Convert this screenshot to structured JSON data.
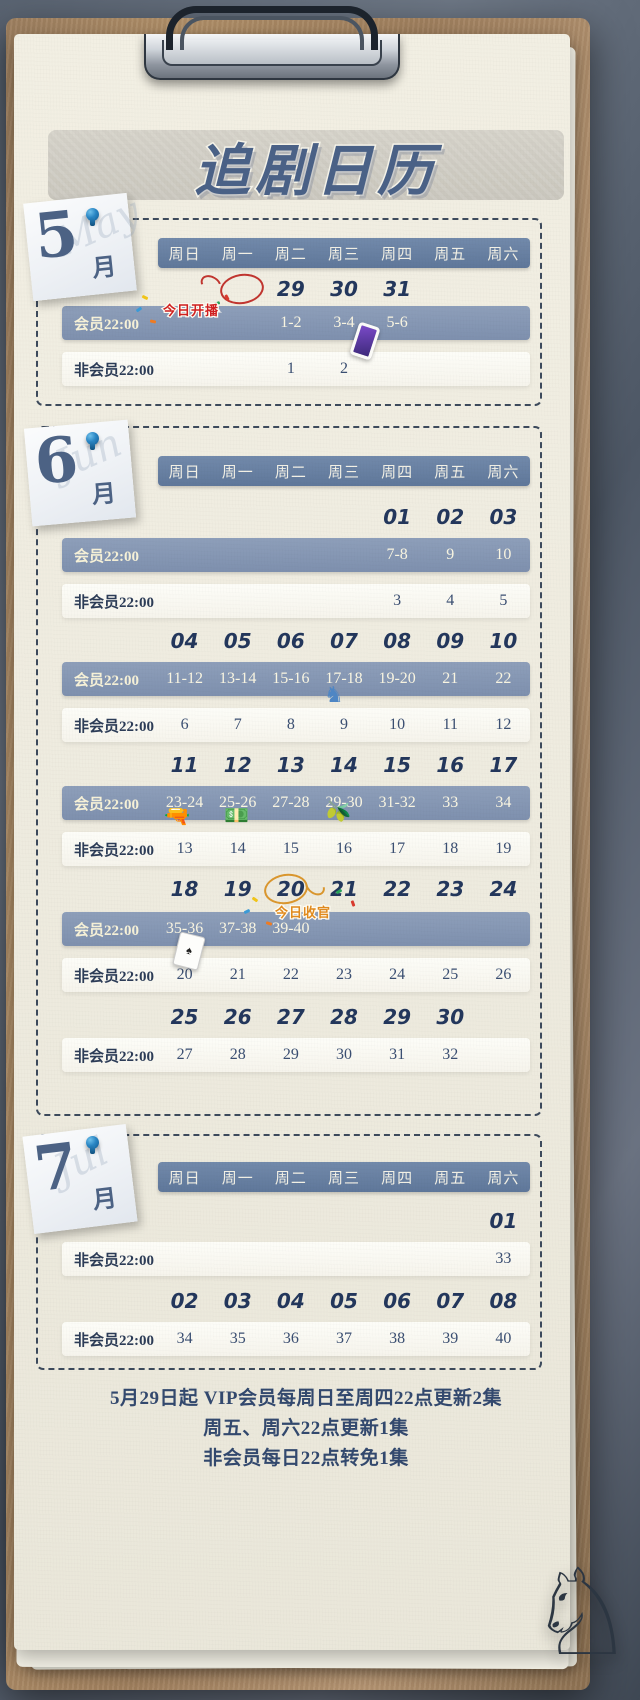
{
  "page": {
    "title": "追剧日历",
    "weekday_headers": [
      "周日",
      "周一",
      "周二",
      "周三",
      "周四",
      "周五",
      "周六"
    ],
    "vip_label": "会员22:00",
    "free_label": "非会员22:00"
  },
  "badges": {
    "premiere": "今日开播",
    "finale": "今日收官"
  },
  "months": [
    {
      "number": "5",
      "unit": "月",
      "script": "May",
      "weeks": [
        {
          "dates": [
            "",
            "",
            "29",
            "30",
            "31",
            "",
            ""
          ],
          "vip": [
            "",
            "",
            "1-2",
            "3-4",
            "5-6",
            "",
            ""
          ],
          "free": [
            "",
            "",
            "1",
            "2",
            "",
            "",
            ""
          ]
        }
      ]
    },
    {
      "number": "6",
      "unit": "月",
      "script": "Jun",
      "weeks": [
        {
          "dates": [
            "",
            "",
            "",
            "",
            "01",
            "02",
            "03"
          ],
          "vip": [
            "",
            "",
            "",
            "",
            "7-8",
            "9",
            "10"
          ],
          "free": [
            "",
            "",
            "",
            "",
            "3",
            "4",
            "5"
          ]
        },
        {
          "dates": [
            "04",
            "05",
            "06",
            "07",
            "08",
            "09",
            "10"
          ],
          "vip": [
            "11-12",
            "13-14",
            "15-16",
            "17-18",
            "19-20",
            "21",
            "22"
          ],
          "free": [
            "6",
            "7",
            "8",
            "9",
            "10",
            "11",
            "12"
          ]
        },
        {
          "dates": [
            "11",
            "12",
            "13",
            "14",
            "15",
            "16",
            "17"
          ],
          "vip": [
            "23-24",
            "25-26",
            "27-28",
            "29-30",
            "31-32",
            "33",
            "34"
          ],
          "free": [
            "13",
            "14",
            "15",
            "16",
            "17",
            "18",
            "19"
          ]
        },
        {
          "dates": [
            "18",
            "19",
            "20",
            "21",
            "22",
            "23",
            "24"
          ],
          "vip": [
            "35-36",
            "37-38",
            "39-40",
            "",
            "",
            "",
            ""
          ],
          "free": [
            "20",
            "21",
            "22",
            "23",
            "24",
            "25",
            "26"
          ]
        },
        {
          "dates": [
            "25",
            "26",
            "27",
            "28",
            "29",
            "30",
            ""
          ],
          "vip": null,
          "free": [
            "27",
            "28",
            "29",
            "30",
            "31",
            "32",
            ""
          ]
        }
      ]
    },
    {
      "number": "7",
      "unit": "月",
      "script": "Jul",
      "weeks": [
        {
          "dates": [
            "",
            "",
            "",
            "",
            "",
            "",
            "01"
          ],
          "vip": null,
          "free": [
            "",
            "",
            "",
            "",
            "",
            "",
            "33"
          ]
        },
        {
          "dates": [
            "02",
            "03",
            "04",
            "05",
            "06",
            "07",
            "08"
          ],
          "vip": null,
          "free": [
            "34",
            "35",
            "36",
            "37",
            "38",
            "39",
            "40"
          ]
        }
      ]
    }
  ],
  "footer": {
    "line1": "5月29日起  VIP会员每周日至周四22点更新2集",
    "line2": "周五、周六22点更新1集",
    "line3": "非会员每日22点转免1集"
  },
  "colors": {
    "header_blue": "#5f779a",
    "vip_bar": "#8e90ae",
    "date_navy": "#23375c",
    "badge_red": "#cf2020",
    "badge_orange": "#e08a1e",
    "paper": "#f0ede1"
  }
}
